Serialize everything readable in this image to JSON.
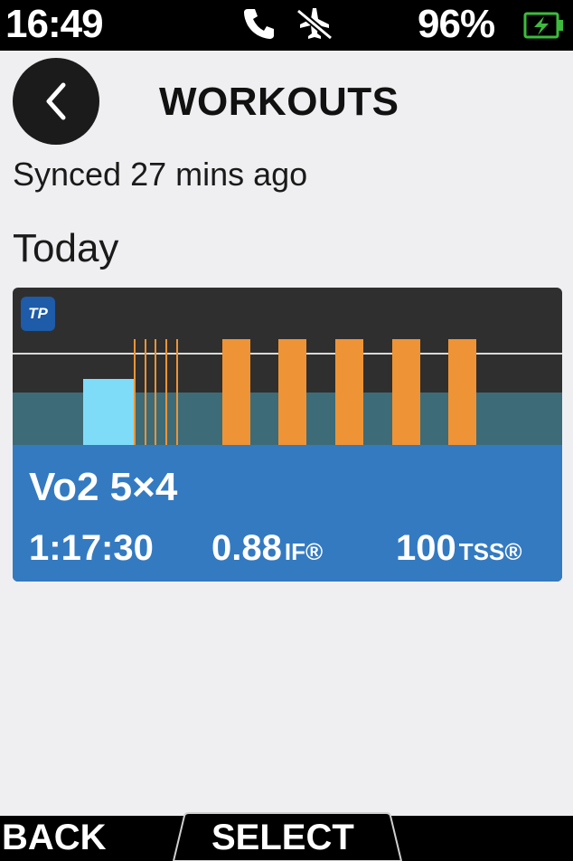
{
  "status_bar": {
    "time": "16:49",
    "battery_percent": "96%",
    "icons": [
      "phone-icon",
      "airplane-off-icon",
      "battery-charging-icon"
    ],
    "battery_color": "#3dbb3d"
  },
  "header": {
    "back_icon": "chevron-left-icon",
    "title": "WORKOUTS"
  },
  "sync_status": "Synced 27 mins ago",
  "section": "Today",
  "workout": {
    "logo_text": "TP",
    "name": "Vo2 5×4",
    "duration": "1:17:30",
    "if_value": "0.88",
    "if_unit": "IF®",
    "tss_value": "100",
    "tss_unit": "TSS®",
    "colors": {
      "card_background": "#2f2f2f",
      "info_background": "#347ac1",
      "threshold_zone": "#3d6b78",
      "warmup_block": "#7fdcf9",
      "interval_block": "#ee9436"
    },
    "intensity_profile": [
      {
        "zone": "warmup",
        "relative_intensity": 0.45
      },
      {
        "zone": "openers",
        "count": 5,
        "relative_intensity": 0.75
      },
      {
        "zone": "vo2max",
        "count": 5,
        "relative_intensity": 0.75
      }
    ]
  },
  "softkeys": {
    "back": "BACK",
    "select": "SELECT"
  }
}
